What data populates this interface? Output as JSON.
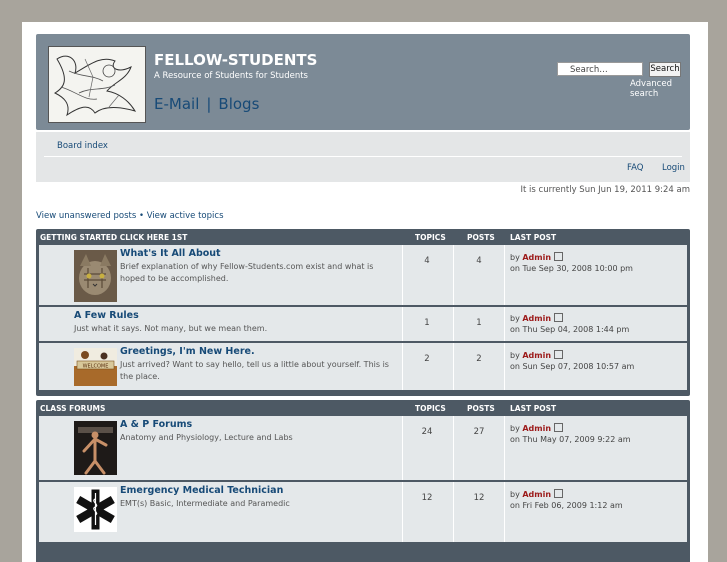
{
  "header": {
    "title": "FELLOW-STUDENTS",
    "description": "A Resource of Students for Students",
    "link_email": "E-Mail",
    "link_sep": "|",
    "link_blogs": "Blogs",
    "search_placeholder": "Search…",
    "search_button": "Search",
    "advanced_search": "Advanced search"
  },
  "nav": {
    "board_index": "Board index",
    "faq": "FAQ",
    "login": "Login"
  },
  "current_time": "It is currently Sun Jun 19, 2011 9:24 am",
  "quicklinks": "View unanswered posts • View active topics",
  "colors": {
    "accent": "#174a77",
    "author": "#9c1a1a",
    "block": "#4d5964",
    "header": "#7c8a96"
  },
  "categories": [
    {
      "name": "GETTING STARTED CLICK HERE 1ST",
      "col_topics": "TOPICS",
      "col_posts": "POSTS",
      "col_last": "LAST POST",
      "forums": [
        {
          "title": "What's It All About",
          "desc": "Brief explanation of why Fellow-Students.com exist and what is hoped to be accomplished.",
          "topics": "4",
          "posts": "4",
          "by": "by",
          "author": "Admin",
          "date": "on Tue Sep 30, 2008 10:00 pm",
          "icon": "cat-photo"
        },
        {
          "title": "A Few Rules",
          "desc": "Just what it says. Not many, but we mean them.",
          "topics": "1",
          "posts": "1",
          "by": "by",
          "author": "Admin",
          "date": "on Thu Sep 04, 2008 1:44 pm",
          "icon": ""
        },
        {
          "title": "Greetings, I'm New Here.",
          "desc": "Just arrived? Want to say hello, tell us a little about yourself. This is the place.",
          "topics": "2",
          "posts": "2",
          "by": "by",
          "author": "Admin",
          "date": "on Sun Sep 07, 2008 10:57 am",
          "icon": "welcome-photo",
          "icon_text": "WELCOME"
        }
      ]
    },
    {
      "name": "CLASS FORUMS",
      "col_topics": "TOPICS",
      "col_posts": "POSTS",
      "col_last": "LAST POST",
      "forums": [
        {
          "title": "A & P Forums",
          "desc": "Anatomy and Physiology, Lecture and Labs",
          "topics": "24",
          "posts": "27",
          "by": "by",
          "author": "Admin",
          "date": "on Thu May 07, 2009 9:22 am",
          "icon": "anatomy-book-photo"
        },
        {
          "title": "Emergency Medical Technician",
          "desc": "EMT(s) Basic, Intermediate and Paramedic",
          "topics": "12",
          "posts": "12",
          "by": "by",
          "author": "Admin",
          "date": "on Fri Feb 06, 2009 1:12 am",
          "icon": "star-of-life-icon"
        }
      ]
    }
  ]
}
